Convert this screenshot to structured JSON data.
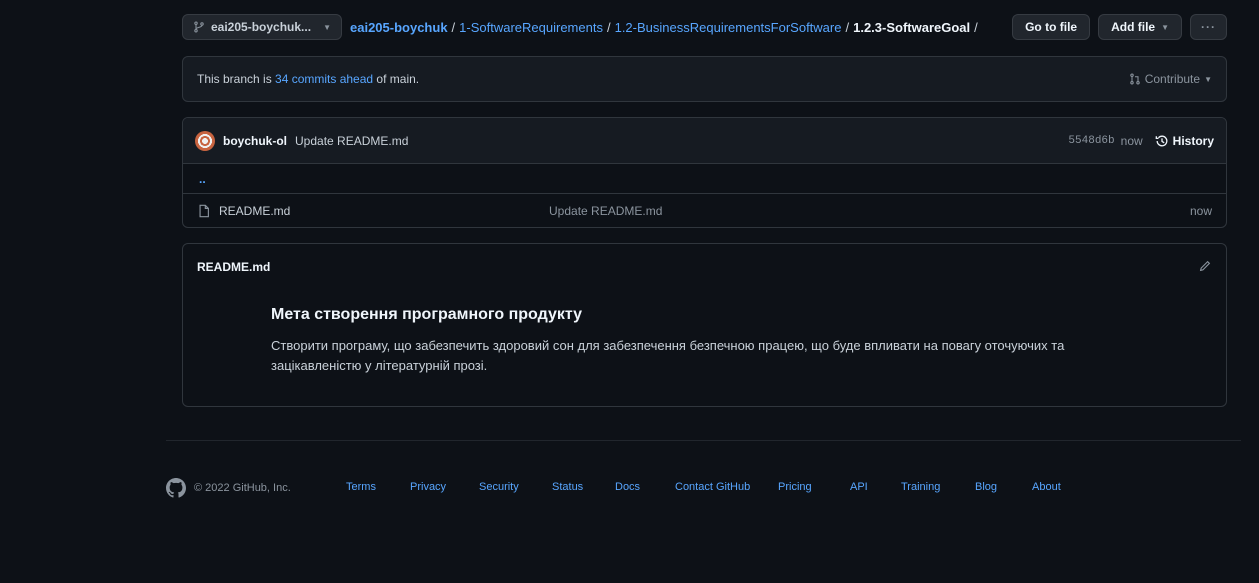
{
  "toolbar": {
    "branch": "eai205-boychuk...",
    "breadcrumb": [
      {
        "label": "eai205-boychuk",
        "type": "repo"
      },
      {
        "label": "1-SoftwareRequirements",
        "type": "link"
      },
      {
        "label": "1.2-BusinessRequirementsForSoftware",
        "type": "link"
      },
      {
        "label": "1.2.3-SoftwareGoal",
        "type": "current"
      }
    ],
    "go_to_file": "Go to file",
    "add_file": "Add file",
    "more": "···"
  },
  "branch_info": {
    "prefix": "This branch is ",
    "link": "34 commits ahead",
    "suffix": " of main.",
    "contribute": "Contribute"
  },
  "commit": {
    "author": "boychuk-ol",
    "message": "Update README.md",
    "sha": "5548d6b",
    "time": "now",
    "history": "History"
  },
  "files": {
    "parent": "..",
    "rows": [
      {
        "name": "README.md",
        "commit": "Update README.md",
        "time": "now"
      }
    ]
  },
  "readme": {
    "title": "README.md",
    "heading": "Мета створення програмного продукту",
    "body": "Створити програму, що забезпечить здоровий сон для забезпечення безпечною працею, що буде впливати на повагу оточуючих та зацікавленістю у літературній прозі."
  },
  "footer": {
    "copyright": "© 2022 GitHub, Inc.",
    "links": [
      "Terms",
      "Privacy",
      "Security",
      "Status",
      "Docs",
      "Contact GitHub",
      "Pricing",
      "API",
      "Training",
      "Blog",
      "About"
    ]
  }
}
